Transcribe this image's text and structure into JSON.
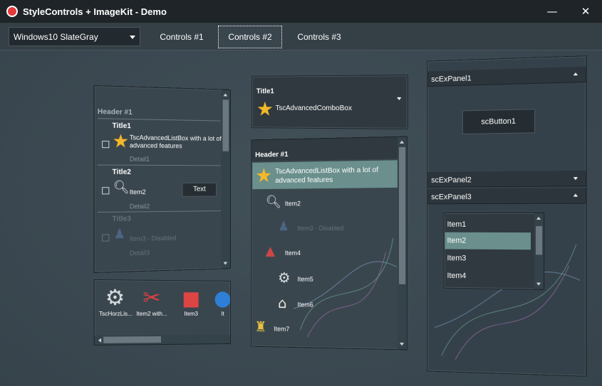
{
  "window": {
    "title": "StyleControls + ImageKit  - Demo",
    "minimize": "—",
    "close": "✕"
  },
  "toolbar": {
    "style_combo": "Windows10 SlateGray",
    "tabs": [
      "Controls #1",
      "Controls #2",
      "Controls #3"
    ],
    "active_tab": "Controls #2"
  },
  "left_list": {
    "header": "Header #1",
    "items": [
      {
        "title": "Title1",
        "text_line1": "TscAdvancedListBox with a lot of",
        "text_line2": "advanced features",
        "detail": "Detail1",
        "icon": "star-icon"
      },
      {
        "title": "Title2",
        "text": "Item2",
        "detail": "Detail2",
        "button": "Text",
        "icon": "search-icon"
      },
      {
        "title": "Title3",
        "text": "Item3 - Disabled",
        "detail": "Detail3",
        "icon": "joystick-icon"
      }
    ]
  },
  "horz_list": {
    "items": [
      {
        "label": "TscHorzLis...",
        "icon": "gear-icon"
      },
      {
        "label": "Item2 with...",
        "icon": "tools-icon"
      },
      {
        "label": "Item3",
        "icon": "cubes-icon"
      },
      {
        "label": "It",
        "icon": "globe-icon"
      }
    ]
  },
  "adv_combo": {
    "title": "Title1",
    "text": "TscAdvancedComboBox",
    "icon": "star-icon"
  },
  "mid_list": {
    "header": "Header #1",
    "items": [
      {
        "text_line1": "TscAdvancedListBox with a lot of",
        "text_line2": "advanced features",
        "icon": "star-icon"
      },
      {
        "text": "Item2",
        "icon": "search-icon"
      },
      {
        "text": "Item3 - Disabled",
        "icon": "joystick-icon"
      },
      {
        "text": "Item4",
        "icon": "shapes-icon"
      },
      {
        "text": "Item5",
        "icon": "gear-icon"
      },
      {
        "text": "Item6",
        "icon": "home-icon"
      },
      {
        "text": "Item7",
        "icon": "objects-icon"
      }
    ]
  },
  "right_panels": {
    "panel1": {
      "title": "scExPanel1",
      "button": "scButton1"
    },
    "panel2": {
      "title": "scExPanel2"
    },
    "panel3": {
      "title": "scExPanel3",
      "items": [
        "Item1",
        "Item2",
        "Item3",
        "Item4"
      ],
      "selected": "Item2"
    }
  },
  "colors": {
    "accent_selection": "#6a8f8d",
    "star": "#f5b828",
    "titlebar": "#1f2428"
  }
}
